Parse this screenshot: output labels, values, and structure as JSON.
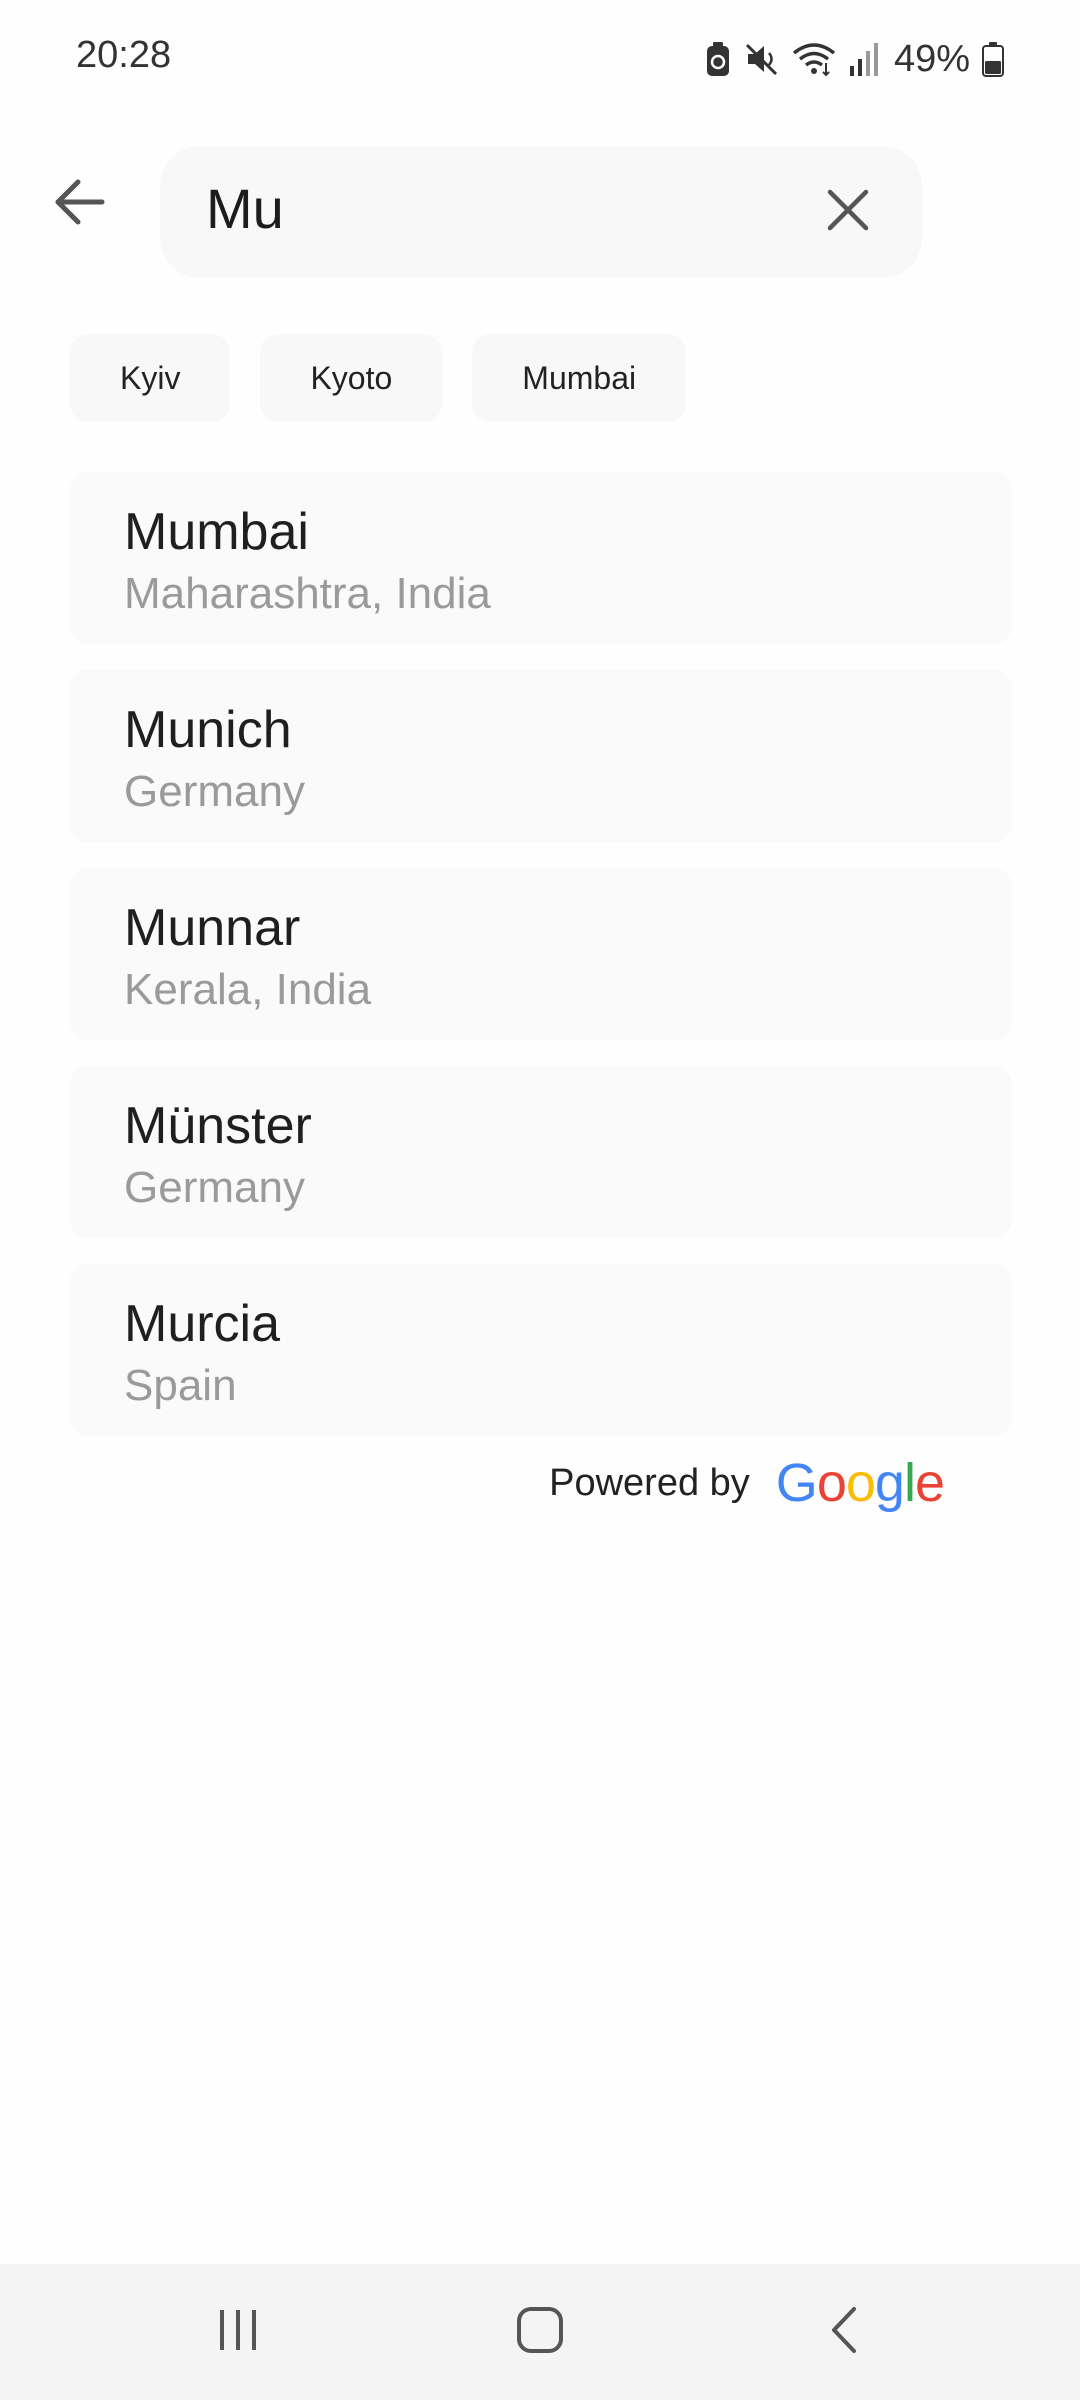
{
  "status_bar": {
    "time": "20:28",
    "icons": [
      "battery-saver-icon",
      "mute-icon",
      "wifi-icon",
      "signal-icon",
      "battery-icon"
    ],
    "battery": "49%"
  },
  "search": {
    "back_icon": "arrow-left-icon",
    "value": "Mu",
    "clear_icon": "close-icon"
  },
  "recent_chips": [
    {
      "label": "Kyiv"
    },
    {
      "label": "Kyoto"
    },
    {
      "label": "Mumbai"
    }
  ],
  "results": [
    {
      "name": "Mumbai",
      "region": "Maharashtra, India"
    },
    {
      "name": "Munich",
      "region": "Germany"
    },
    {
      "name": "Munnar",
      "region": "Kerala, India"
    },
    {
      "name": "Münster",
      "region": "Germany"
    },
    {
      "name": "Murcia",
      "region": "Spain"
    }
  ],
  "attribution": {
    "powered_by": "Powered by",
    "logo_text": "Google",
    "logo_colors": [
      "#4285F4",
      "#EA4335",
      "#FBBC05",
      "#4285F4",
      "#34A853",
      "#EA4335"
    ]
  },
  "nav_bar": {
    "icons": [
      "recents-icon",
      "home-icon",
      "back-icon"
    ]
  }
}
